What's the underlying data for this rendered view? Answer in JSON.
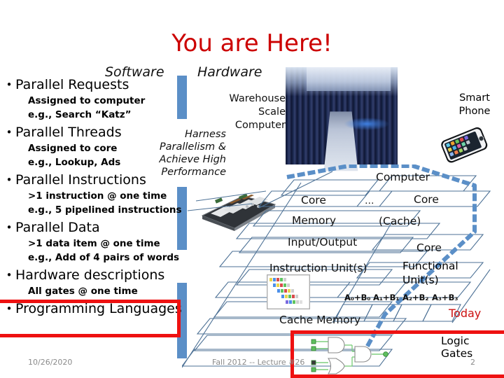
{
  "slide": {
    "title": "You are Here!",
    "title_color": "#CC0000",
    "footer": {
      "date": "10/26/2020",
      "center": "Fall 2012 -- Lecture #26",
      "page_number": "2"
    }
  },
  "columns": {
    "software_heading": "Software",
    "hardware_heading": "Hardware"
  },
  "harness": {
    "lines": [
      "Harness",
      "Parallelism &",
      "Achieve High",
      "Performance"
    ]
  },
  "bullets": [
    {
      "label": "Parallel Requests",
      "subs": [
        "Assigned to computer",
        "e.g., Search “Katz”"
      ],
      "highlighted": false
    },
    {
      "label": "Parallel Threads",
      "subs": [
        "Assigned to core",
        "e.g., Lookup, Ads"
      ],
      "highlighted": false
    },
    {
      "label": "Parallel Instructions",
      "subs": [
        ">1 instruction @ one time",
        "e.g., 5 pipelined instructions"
      ],
      "highlighted": false
    },
    {
      "label": "Parallel Data",
      "subs": [
        ">1 data item @ one time",
        "e.g., Add of 4 pairs of words"
      ],
      "highlighted": false
    },
    {
      "label": "Hardware descriptions",
      "subs": [
        "All gates @ one time"
      ],
      "highlighted": true
    },
    {
      "label": "Programming Languages",
      "subs": [],
      "highlighted": false
    }
  ],
  "hardware_diagram": {
    "warehouse_label_lines": [
      "Warehouse",
      "Scale",
      "Computer"
    ],
    "smartphone_label_lines": [
      "Smart",
      "Phone"
    ],
    "computer_label": "Computer",
    "core_left_label": "Core",
    "core_ellipsis": "…",
    "core_right_label": "Core",
    "memory_label": "Memory",
    "cache_label": "(Cache)",
    "io_label": "Input/Output",
    "core_lower_label": "Core",
    "instruction_unit_label": "Instruction Unit(s)",
    "functional_unit_lines": [
      "Functional",
      "Unit(s)"
    ],
    "adder_cells": [
      "A₀+B₀",
      "A₁+B₁",
      "A₂+B₂",
      "A₃+B₃"
    ],
    "cache_memory_label": "Cache Memory",
    "logic_gates_label": "Logic Gates",
    "today_label": "Today",
    "today_color": "#CC1111"
  },
  "colors": {
    "accent_blue": "#5B8FC7",
    "layer_outline": "#4E7296",
    "highlight_red": "#EE1111",
    "footer_gray": "#8a8a8a"
  }
}
